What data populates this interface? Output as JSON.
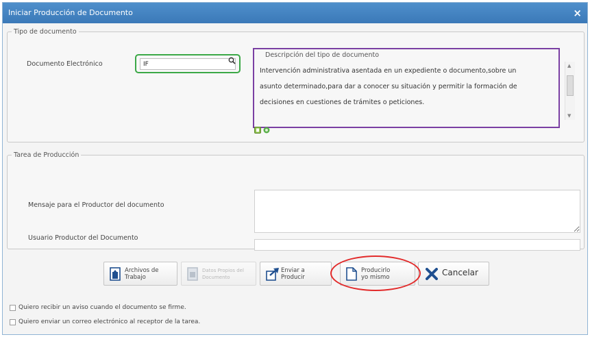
{
  "dialog": {
    "title": "Iniciar Producción de Documento",
    "close_label": "×"
  },
  "tipo": {
    "legend": "Tipo de documento",
    "doc_label": "Documento Electrónico",
    "search_value": "IF",
    "desc_title": "Descripción del tipo de documento",
    "desc_lines": [
      "Intervención administrativa asentada en un expediente o documento,sobre un",
      "asunto determinado,para dar a conocer su situación y permitir la formación de",
      "decisiones en cuestiones de trámites o peticiones."
    ]
  },
  "tarea": {
    "legend": "Tarea de Producción",
    "mensaje_label": "Mensaje para el Productor del documento",
    "usuario_label": "Usuario Productor del Documento",
    "mensaje_value": "",
    "usuario_value": ""
  },
  "buttons": {
    "archivos": [
      "Archivos de",
      "Trabajo"
    ],
    "datos": [
      "Datos Propios del",
      "Documento"
    ],
    "enviar": [
      "Enviar a",
      "Producir"
    ],
    "producirlo": [
      "Producirlo",
      "yo mismo"
    ],
    "cancelar": "Cancelar"
  },
  "checkboxes": {
    "aviso": "Quiero recibir un aviso cuando el documento se firme.",
    "correo": "Quiero enviar un correo electrónico al receptor de la tarea."
  },
  "colors": {
    "titlebar": "#3b79b8",
    "search_highlight": "#3ba846",
    "desc_highlight": "#7a3fa3",
    "circle_highlight": "#e22a2a",
    "cancel_icon": "#1f4f8f"
  }
}
